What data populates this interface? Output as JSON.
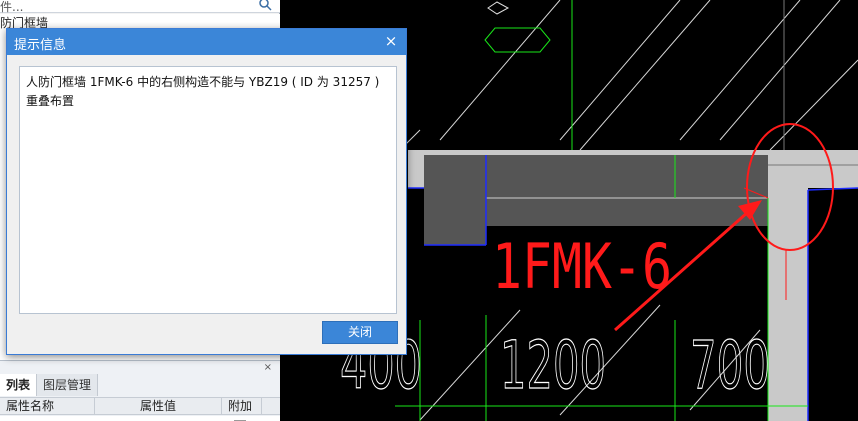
{
  "left_panel": {
    "search_placeholder": "件...",
    "tree_item": "防门框墙",
    "icons": {
      "search": "search-icon",
      "pane_close": "close-icon"
    }
  },
  "bottom_pane": {
    "close_glyph": "×",
    "tabs": [
      {
        "label": "列表",
        "active": true
      },
      {
        "label": "图层管理",
        "active": false
      }
    ],
    "columns": [
      "属性名称",
      "属性值",
      "附加"
    ]
  },
  "dialog": {
    "title": "提示信息",
    "close_glyph": "×",
    "message": "人防门框墙 1FMK-6 中的右侧构造不能与 YBZ19 ( ID 为 31257 ) 重叠布置",
    "button_label": "关闭"
  },
  "cad": {
    "label_text": "1FMK-6",
    "dimensions": [
      "400",
      "1200",
      "700"
    ],
    "colors": {
      "background": "#000000",
      "wall_dark": "#555555",
      "wall_light": "#c9c9c9",
      "green": "#19e619",
      "red": "#ff1a1a",
      "blue": "#1e2cff"
    }
  }
}
